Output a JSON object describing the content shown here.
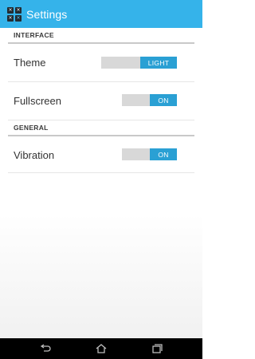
{
  "header": {
    "title": "Settings",
    "icon_glyphs": [
      "×",
      "×",
      "×",
      "×"
    ],
    "background": "#35b3ea"
  },
  "sections": {
    "interface": {
      "label": "INTERFACE"
    },
    "general": {
      "label": "GENERAL"
    }
  },
  "settings": {
    "theme": {
      "label": "Theme",
      "value": "LIGHT"
    },
    "fullscreen": {
      "label": "Fullscreen",
      "value": "ON"
    },
    "vibration": {
      "label": "Vibration",
      "value": "ON"
    }
  },
  "navbar": {
    "buttons": [
      "back-icon",
      "home-icon",
      "recent-apps-icon"
    ]
  },
  "colors": {
    "accent": "#2aa0d4",
    "toggle_off": "#d8d8d8"
  }
}
